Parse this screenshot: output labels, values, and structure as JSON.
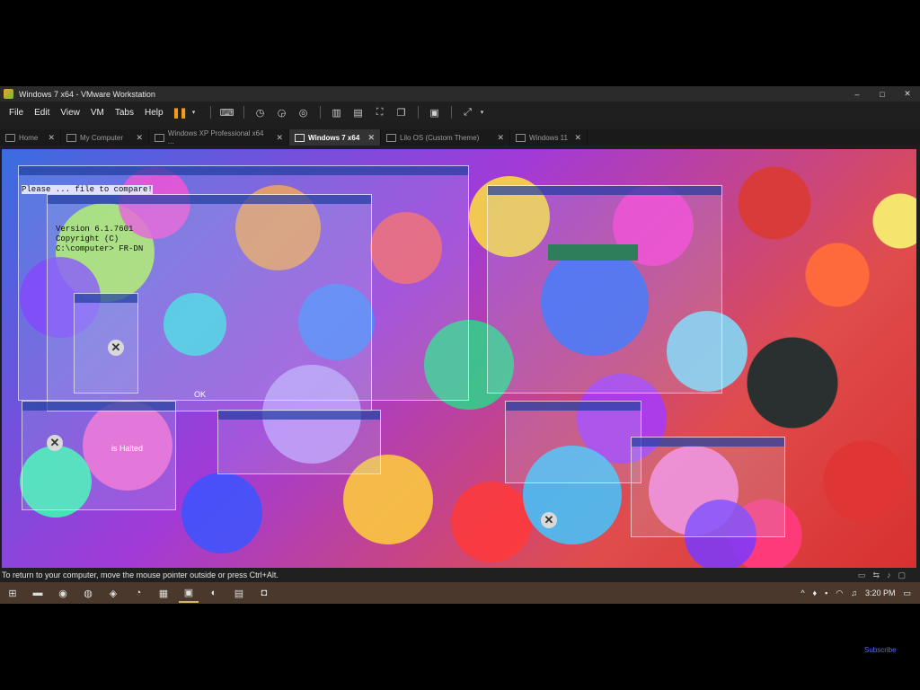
{
  "window": {
    "title": "Windows 7 x64 - VMware Workstation",
    "controls": {
      "minimize": "–",
      "maximize": "□",
      "close": "✕"
    }
  },
  "menu": {
    "items": [
      "File",
      "Edit",
      "View",
      "VM",
      "Tabs",
      "Help"
    ]
  },
  "tabs": [
    {
      "label": "Home",
      "icon": "home-icon",
      "active": false
    },
    {
      "label": "My Computer",
      "icon": "computer-icon",
      "active": false
    },
    {
      "label": "Windows XP Professional x64 ...",
      "icon": "vm-icon",
      "active": false
    },
    {
      "label": "Windows 7 x64",
      "icon": "vm-icon",
      "active": true
    },
    {
      "label": "Lilo OS (Custom Theme)",
      "icon": "vm-icon",
      "active": false
    },
    {
      "label": "Windows 11",
      "icon": "vm-icon",
      "active": false
    }
  ],
  "guest": {
    "glitch_texts": [
      "Please ... file to compare!",
      "Version 6.1.7601",
      "Copyright (C)",
      "C:\\computer> FR-DN",
      "is Halted",
      "OK"
    ]
  },
  "status": {
    "message": "To return to your computer, move the mouse pointer outside or press Ctrl+Alt."
  },
  "taskbar": {
    "clock": "3:20 PM"
  },
  "overlay": {
    "subscribe": "Subscribe"
  },
  "colors": {
    "pause_accent": "#f39a1e",
    "taskbar_bg": "#4a382c",
    "tab_active_bg": "#333333"
  }
}
